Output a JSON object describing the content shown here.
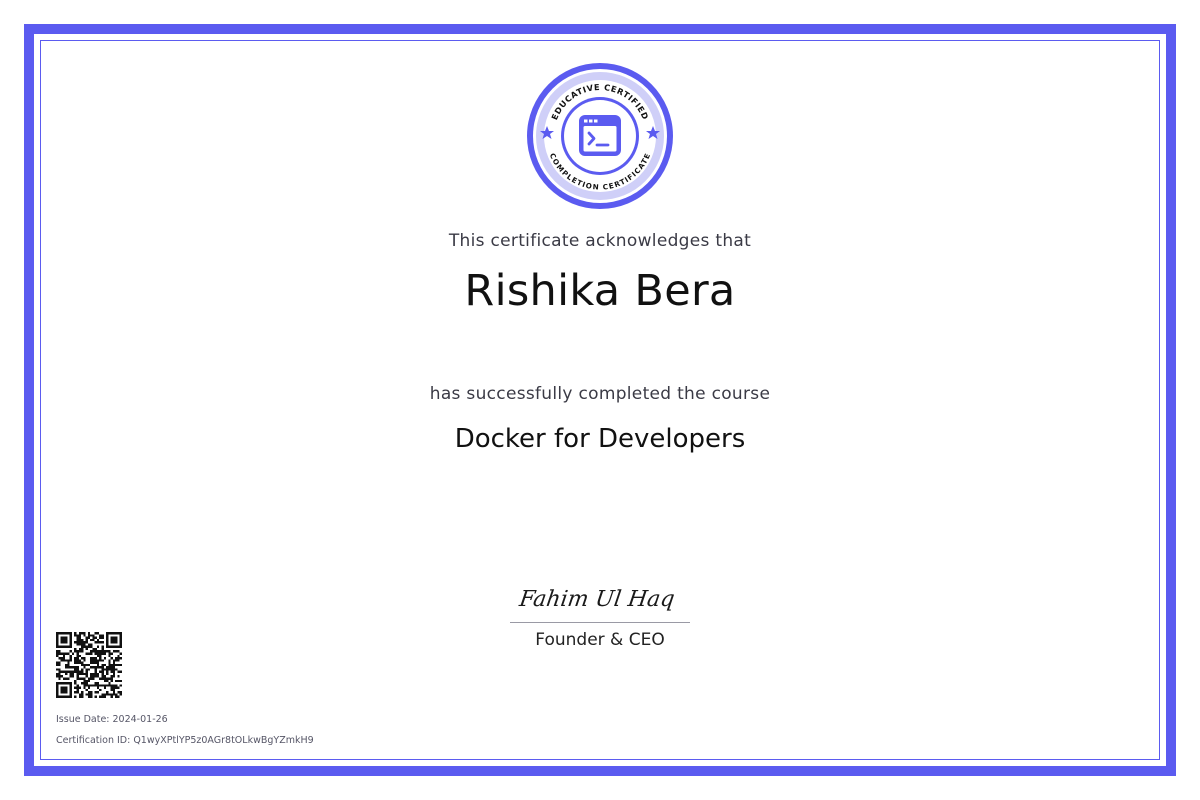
{
  "badge": {
    "top_text": "EDUCATIVE CERTIFIED",
    "bottom_text": "COMPLETION CERTIFICATE",
    "icon": "terminal-window-icon",
    "color": "#5b5bf0"
  },
  "acknowledgement": "This certificate acknowledges that",
  "recipient_name": "Rishika Bera",
  "completion_text": "has successfully completed the course",
  "course_title": "Docker for Developers",
  "signature": {
    "signer_name": "Fahim Ul Haq",
    "signer_title": "Founder & CEO"
  },
  "issue": {
    "label": "Issue Date:",
    "value": "2024-01-26"
  },
  "certification": {
    "label": "Certification ID:",
    "value": "Q1wyXPtlYP5z0AGr8tOLkwBgYZmkH9"
  },
  "colors": {
    "accent": "#5b5bf0",
    "badge_light": "#c9c9f7"
  }
}
